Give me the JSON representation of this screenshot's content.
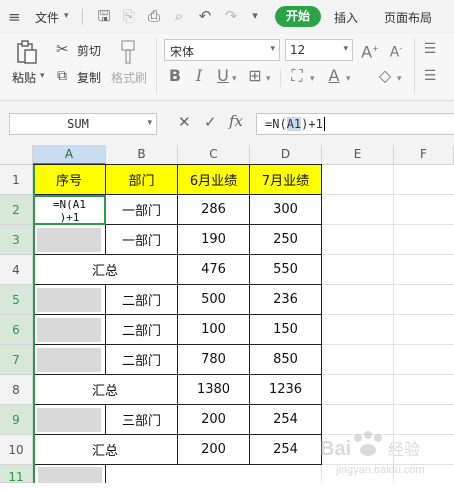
{
  "menu": {
    "file_label": "文件",
    "start_label": "开始",
    "insert_label": "插入",
    "page_layout_label": "页面布局"
  },
  "ribbon": {
    "paste_label": "粘贴",
    "cut_label": "剪切",
    "copy_label": "复制",
    "format_painter_label": "格式刷",
    "font_name": "宋体",
    "font_size": "12"
  },
  "formula_bar": {
    "name_box": "SUM",
    "fx_label": "fx",
    "formula_prefix": "=N(",
    "formula_ref": "A1",
    "formula_suffix": ")+1"
  },
  "columns": [
    "A",
    "B",
    "C",
    "D",
    "E",
    "F"
  ],
  "rows": [
    "1",
    "2",
    "3",
    "4",
    "5",
    "6",
    "7",
    "8",
    "9",
    "10",
    "11"
  ],
  "table": {
    "header": {
      "seq": "序号",
      "dept": "部门",
      "june": "6月业绩",
      "july": "7月业绩"
    },
    "editing_text": "=N(A1\n)+1",
    "r2": {
      "dept": "一部门",
      "june": "286",
      "july": "300"
    },
    "r3": {
      "dept": "一部门",
      "june": "190",
      "july": "250"
    },
    "r4": {
      "label": "汇总",
      "june": "476",
      "july": "550"
    },
    "r5": {
      "dept": "二部门",
      "june": "500",
      "july": "236"
    },
    "r6": {
      "dept": "二部门",
      "june": "100",
      "july": "150"
    },
    "r7": {
      "dept": "二部门",
      "june": "780",
      "july": "850"
    },
    "r8": {
      "label": "汇总",
      "june": "1380",
      "july": "1236"
    },
    "r9": {
      "dept": "三部门",
      "june": "200",
      "july": "254"
    },
    "r10": {
      "label": "汇总",
      "june": "200",
      "july": "254"
    }
  },
  "watermark": "Bai 经验 jingyan.baidu.com",
  "colors": {
    "start_green": "#2aa447",
    "header_yellow": "#ffff00",
    "placeholder_grey": "#d9d9d9",
    "selection_green": "#2b9a4a"
  }
}
